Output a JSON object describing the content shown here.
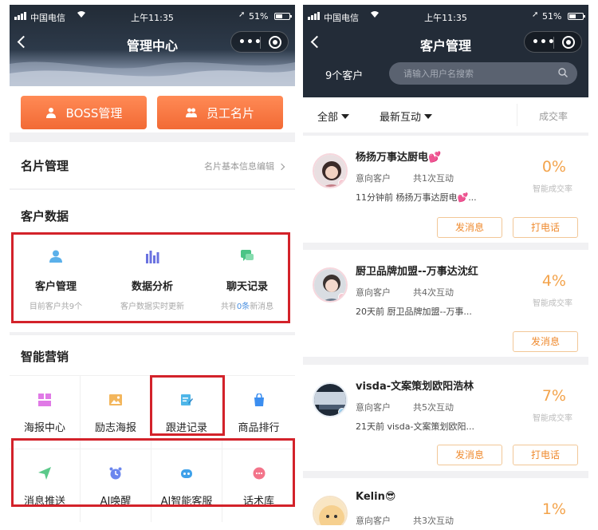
{
  "status": {
    "carrier": "中国电信",
    "time": "上午11:35",
    "battery": "51%"
  },
  "left": {
    "nav_title": "管理中心",
    "boss_btn": "BOSS管理",
    "staff_btn": "员工名片",
    "card_mgmt": {
      "title": "名片管理",
      "hint": "名片基本信息编辑"
    },
    "customer_data": {
      "title": "客户数据",
      "items": [
        {
          "name": "客户管理",
          "sub": "目前客户共9个"
        },
        {
          "name": "数据分析",
          "sub": "客户数据实时更新"
        },
        {
          "name": "聊天记录",
          "sub_pre": "共有",
          "sub_num": "0条",
          "sub_post": "新消息"
        }
      ]
    },
    "marketing": {
      "title": "智能营销",
      "items": [
        "海报中心",
        "励志海报",
        "跟进记录",
        "商品排行",
        "消息推送",
        "AI唤醒",
        "AI智能客服",
        "话术库"
      ]
    }
  },
  "right": {
    "nav_title": "客户管理",
    "count": "9个客户",
    "search_placeholder": "请输入用户名搜索",
    "filters": {
      "all": "全部",
      "recent": "最新互动",
      "rate": "成交率"
    },
    "rate_label": "智能成交率",
    "customers": [
      {
        "name": "杨扬万事达厨电💕",
        "tag": "意向客户",
        "interactions": "共1次互动",
        "last": "11分钟前 杨扬万事达厨电💕...",
        "rate": "0%",
        "actions": [
          "发消息",
          "打电话"
        ]
      },
      {
        "name": "厨卫品牌加盟--万事达沈红",
        "tag": "意向客户",
        "interactions": "共4次互动",
        "last": "20天前 厨卫品牌加盟--万事...",
        "rate": "4%",
        "actions": [
          "发消息"
        ]
      },
      {
        "name": "visda-文案策划欧阳浩林",
        "tag": "意向客户",
        "interactions": "共5次互动",
        "last": "21天前 visda-文案策划欧阳...",
        "rate": "7%",
        "actions": [
          "发消息",
          "打电话"
        ]
      },
      {
        "name": "Kelin😎",
        "tag": "意向客户",
        "interactions": "共3次互动",
        "rate": "1%"
      }
    ]
  },
  "colors": {
    "accent_orange": "#f26a35",
    "highlight_red": "#d3222a",
    "rate_orange": "#f3a34b",
    "dark_header": "#232c38"
  }
}
